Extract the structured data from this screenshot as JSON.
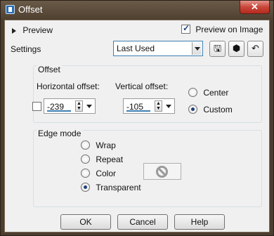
{
  "window": {
    "title": "Offset",
    "close_glyph": "✕"
  },
  "preview": {
    "toggle_label": "Preview",
    "preview_on_image_label": "Preview on Image",
    "preview_on_image_checked": true
  },
  "settings": {
    "label": "Settings",
    "selected": "Last Used",
    "tool_icons": [
      "save-icon",
      "reset-icon",
      "undo-icon"
    ]
  },
  "offset": {
    "group_title": "Offset",
    "horizontal_label": "Horizontal offset:",
    "horizontal_value": "-239",
    "vertical_label": "Vertical offset:",
    "vertical_value": "-105",
    "mode_options": [
      "Center",
      "Custom"
    ],
    "mode_selected": "Custom"
  },
  "edge_mode": {
    "group_title": "Edge mode",
    "options": [
      "Wrap",
      "Repeat",
      "Color",
      "Transparent"
    ],
    "selected": "Transparent"
  },
  "buttons": {
    "ok": "OK",
    "cancel": "Cancel",
    "help": "Help"
  },
  "colors": {
    "accent": "#3c7fb1",
    "close": "#c8463a"
  }
}
